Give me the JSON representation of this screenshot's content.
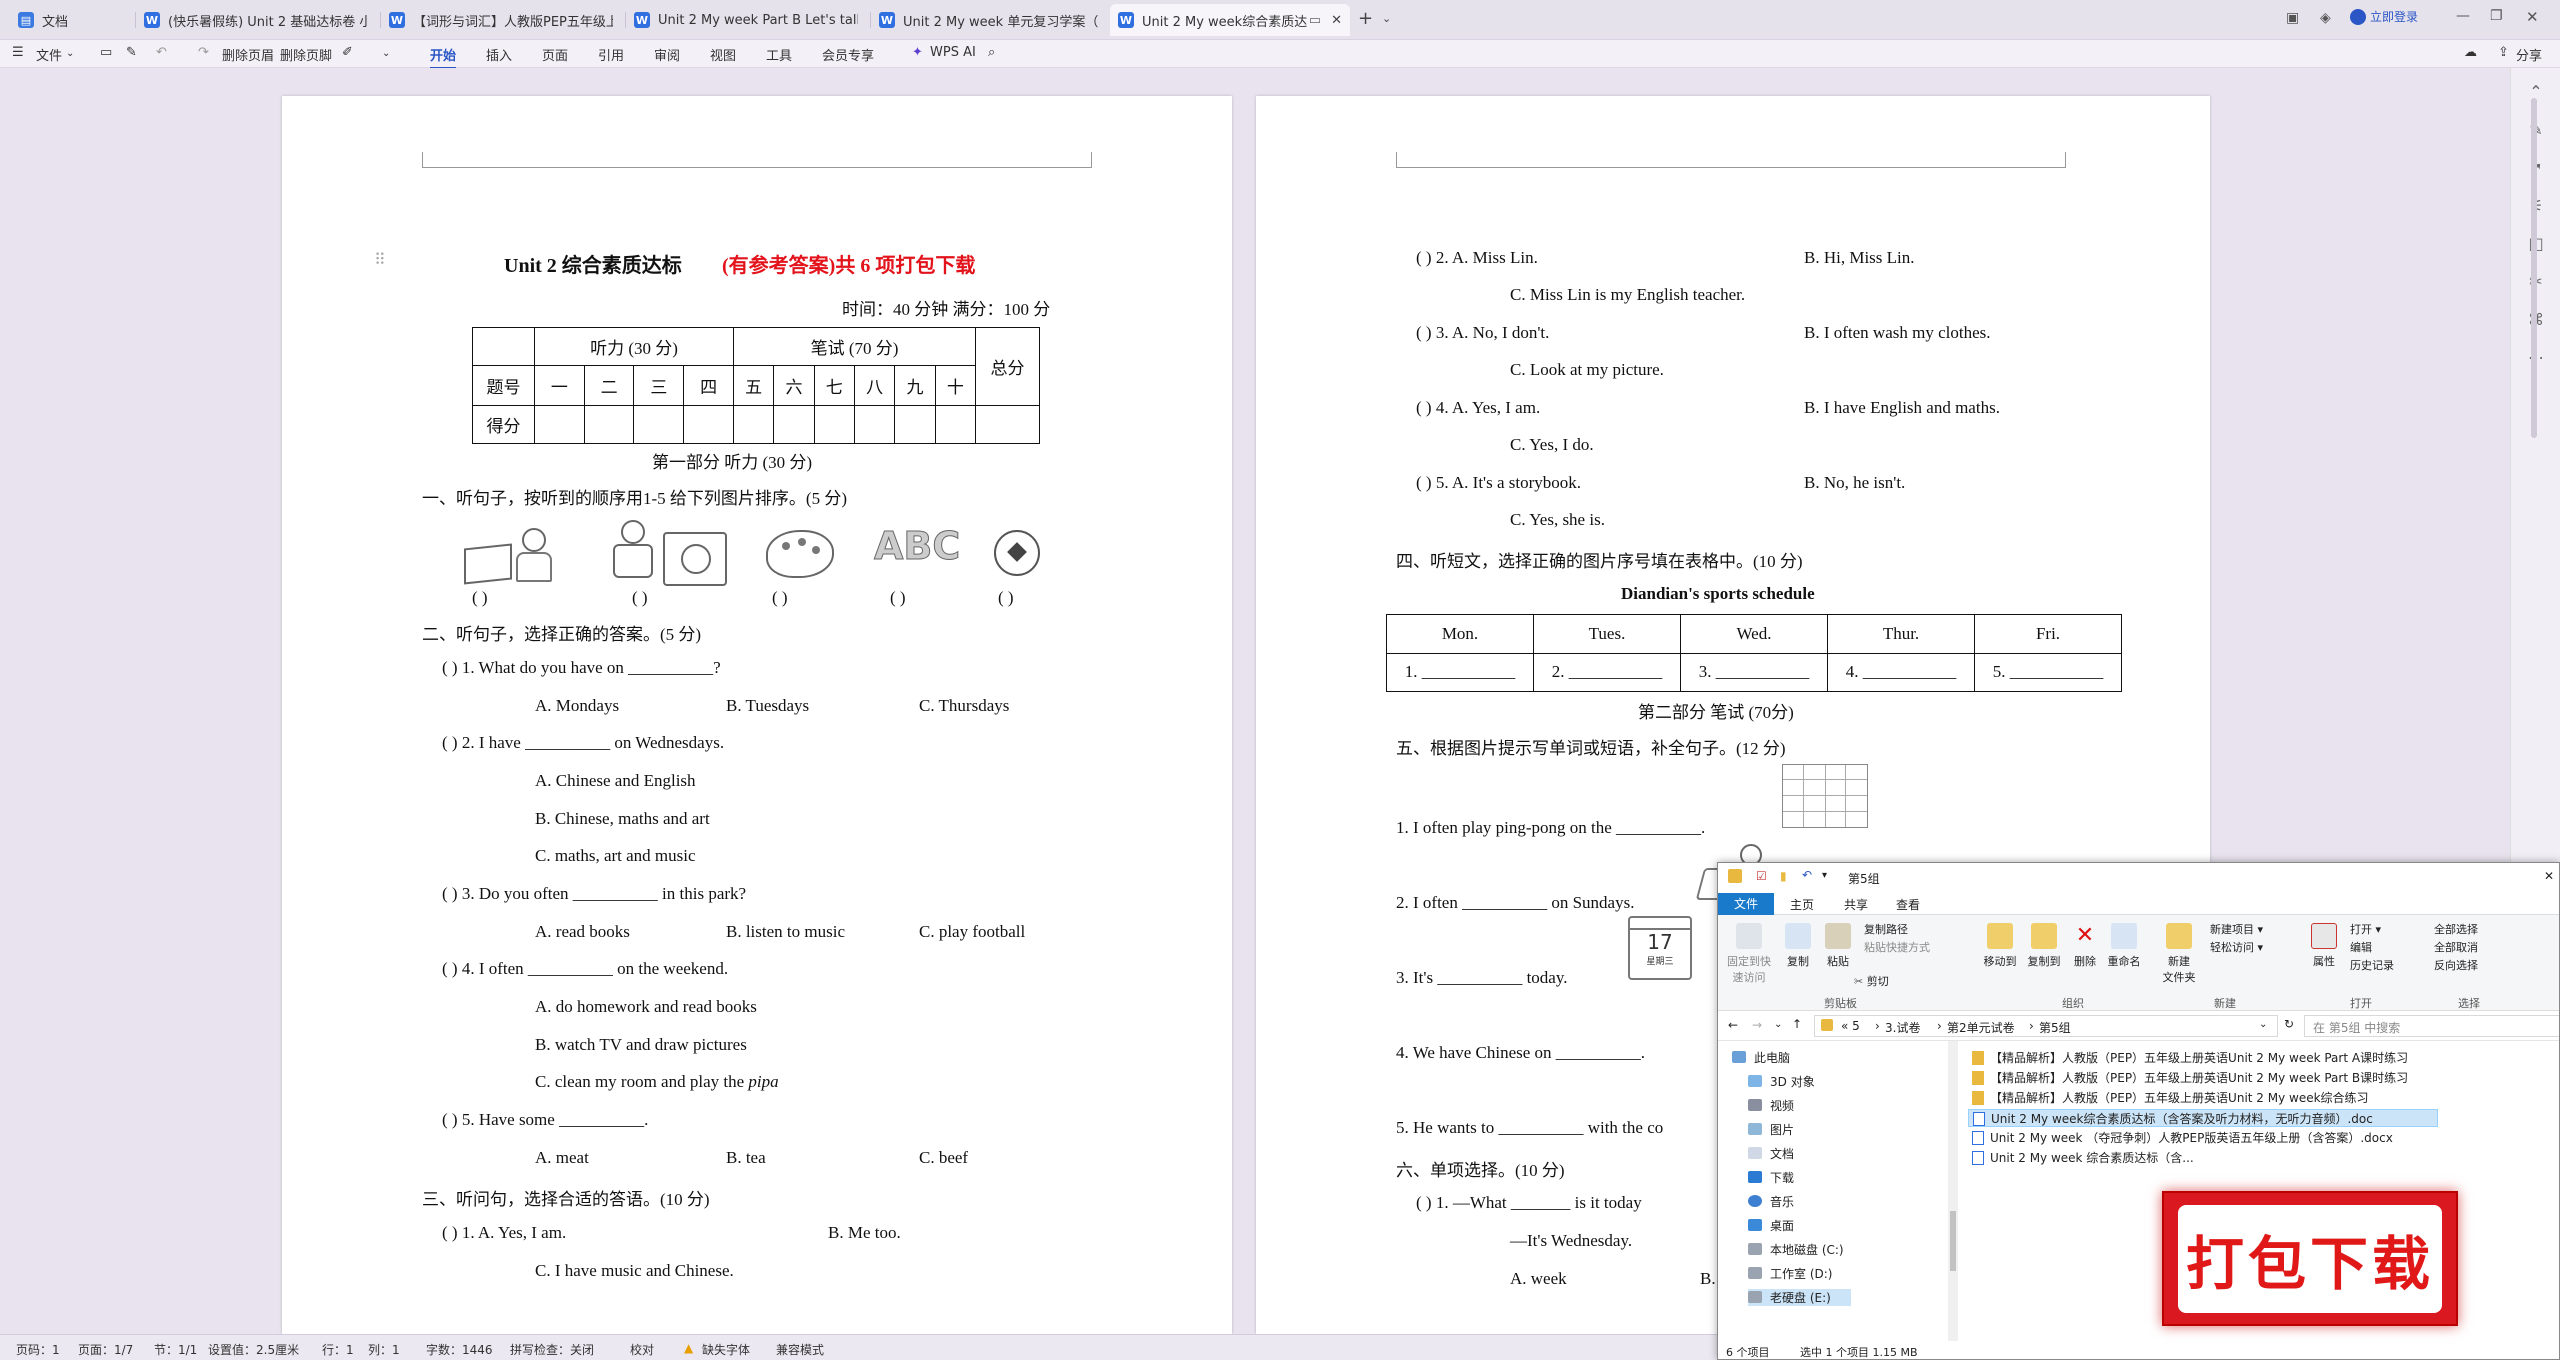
{
  "tabs": [
    {
      "label": "文档",
      "icon": "docs-home-icon",
      "color": "#3b7ae0",
      "active": false
    },
    {
      "label": "(快乐暑假练) Unit 2 基础达标卷 小",
      "icon": "wps-doc-icon",
      "color": "#2f6fe0",
      "active": false
    },
    {
      "label": "【词形与词汇】人教版PEP五年级上册",
      "icon": "wps-doc-icon",
      "color": "#2f6fe0",
      "active": false
    },
    {
      "label": "Unit 2 My week   Part B Let's talk",
      "icon": "wps-doc-icon",
      "color": "#2f6fe0",
      "active": false
    },
    {
      "label": "Unit 2 My week 单元复习学案（知识",
      "icon": "wps-doc-icon",
      "color": "#2f6fe0",
      "active": false
    },
    {
      "label": "Unit 2    My week综合素质达",
      "icon": "wps-doc-icon",
      "color": "#2f6fe0",
      "active": true
    }
  ],
  "titlebar": {
    "login": "立即登录"
  },
  "menu": {
    "file": "文件",
    "delete_header": "删除页眉",
    "delete_footer": "删除页脚",
    "items": [
      "开始",
      "插入",
      "页面",
      "引用",
      "审阅",
      "视图",
      "工具",
      "会员专享"
    ],
    "active": "开始",
    "wps_ai": "WPS AI",
    "share": "分享"
  },
  "left_page": {
    "title": "Unit 2  综合素质达标",
    "title_red": "(有参考答案)共 6 项打包下载",
    "time": "时间：40 分钟    满分：100 分",
    "score_table": {
      "listen": "听力 (30 分)",
      "written": "笔试 (70 分)",
      "total": "总分",
      "row_label": "题号",
      "score_label": "得分",
      "nums": [
        "一",
        "二",
        "三",
        "四",
        "五",
        "六",
        "七",
        "八",
        "九",
        "十"
      ]
    },
    "part1": "第一部分      听力 (30 分)",
    "q1": "一、听句子，按听到的顺序用1-5  给下列图片排序。(5  分)",
    "paren": "(        )",
    "q2": "二、听句子，选择正确的答案。(5  分)",
    "q2_items": [
      {
        "stem": "(        ) 1. What do you have on __________?",
        "opts": [
          "A. Mondays",
          "B. Tuesdays",
          "C. Thursdays"
        ]
      },
      {
        "stem": "(        ) 2. I have __________ on Wednesdays.",
        "opts": [
          "A. Chinese and English",
          "B. Chinese, maths and art",
          "C. maths, art and music"
        ]
      },
      {
        "stem": "(        ) 3. Do you often __________ in this park?",
        "opts": [
          "A. read books",
          "B. listen to music",
          "C. play football"
        ]
      },
      {
        "stem": "(        ) 4. I often __________ on the weekend.",
        "opts": [
          "A. do homework and read books",
          "B. watch TV and draw pictures",
          "C. clean my room and play the "
        ]
      },
      {
        "stem": "(        ) 5. Have some __________.",
        "opts": [
          "A. meat",
          "B. tea",
          "C. beef"
        ]
      }
    ],
    "pipa": "pipa",
    "q3": "三、听问句，选择合适的答语。(10  分)",
    "q3_1": {
      "stem": "(        ) 1. A. Yes, I am.",
      "b": "B. Me too.",
      "c": "C. I have music and Chinese."
    }
  },
  "right_page": {
    "items": [
      {
        "stem": "(        ) 2. A. Miss Lin.",
        "b": "B. Hi, Miss Lin.",
        "c": "C. Miss Lin is my English teacher."
      },
      {
        "stem": "(        ) 3. A. No, I don't.",
        "b": "B. I often wash my clothes.",
        "c": "C. Look at my picture."
      },
      {
        "stem": "(        ) 4. A. Yes, I am.",
        "b": "B. I have English and maths.",
        "c": "C. Yes, I do."
      },
      {
        "stem": "(        ) 5. A. It's a storybook.",
        "b": "B. No, he isn't.",
        "c": "C. Yes, she is."
      }
    ],
    "q4": "四、听短文，选择正确的图片序号填在表格中。(10  分)",
    "schedule_title": "Diandian's sports schedule",
    "days": [
      "Mon.",
      "Tues.",
      "Wed.",
      "Thur.",
      "Fri."
    ],
    "blanks": [
      "1. ___________",
      "2. ___________",
      "3. ___________",
      "4. ___________",
      "5. ___________"
    ],
    "part2": "第二部分    笔试  (70分)",
    "q5": "五、根据图片提示写单词或短语，补全句子。(12  分)",
    "q5_items": [
      "1. I often play ping-pong on the __________.",
      "2. I often __________ on Sundays.",
      "3. It's __________ today.",
      "4. We have Chinese on __________.",
      "5. He wants to __________ with the co"
    ],
    "calendar_day": "17",
    "calendar_week": "星期三",
    "q6": "六、单项选择。(10  分)",
    "q6_1": "(        ) 1. —What _______ is it today",
    "q6_1_ans": "—It's Wednesday.",
    "q6_1_a": "A. week",
    "q6_1_b": "B."
  },
  "status": {
    "page": "页码：1",
    "pages": "页面：1/7",
    "section": "节：1/1",
    "setting": "设置值：2.5厘米",
    "row": "行：1",
    "col": "列：1",
    "words": "字数：1446",
    "spell": "拼写检查：关闭",
    "proof": "校对",
    "font_missing": "缺失字体",
    "compat": "兼容模式"
  },
  "explorer": {
    "title": "第5组",
    "tabs": [
      "文件",
      "主页",
      "共享",
      "查看"
    ],
    "ribbon": {
      "pin": "固定到快\n速访问",
      "copy": "复制",
      "paste": "粘贴",
      "copy_path": "复制路径",
      "paste_shortcut": "粘贴快捷方式",
      "cut": "剪切",
      "move_to": "移动到",
      "copy_to": "复制到",
      "delete": "删除",
      "rename": "重命名",
      "new_folder": "新建\n文件夹",
      "new_item": "新建项目",
      "easy_access": "轻松访问",
      "properties": "属性",
      "open": "打开",
      "edit": "编辑",
      "history": "历史记录",
      "select_all": "全部选择",
      "select_none": "全部取消",
      "invert": "反向选择",
      "g_clipboard": "剪贴板",
      "g_organize": "组织",
      "g_new": "新建",
      "g_open": "打开",
      "g_select": "选择"
    },
    "breadcrumb": [
      "«  5",
      "3.试卷",
      "第2单元试卷",
      "第5组"
    ],
    "search_placeholder": "在 第5组 中搜索",
    "nav": [
      "此电脑",
      "3D 对象",
      "视频",
      "图片",
      "文档",
      "下载",
      "音乐",
      "桌面",
      "本地磁盘 (C:)",
      "工作室 (D:)",
      "老硬盘 (E:)"
    ],
    "files": [
      {
        "name": "【精品解析】人教版（PEP）五年级上册英语Unit 2 My week Part A课时练习",
        "type": "folder"
      },
      {
        "name": "【精品解析】人教版（PEP）五年级上册英语Unit 2 My week Part B课时练习",
        "type": "folder"
      },
      {
        "name": "【精品解析】人教版（PEP）五年级上册英语Unit 2 My week综合练习",
        "type": "folder"
      },
      {
        "name": "Unit 2    My week综合素质达标（含答案及听力材料，无听力音频）.doc",
        "type": "doc",
        "selected": true
      },
      {
        "name": "Unit 2 My week （夺冠争刺）人教PEP版英语五年级上册（含答案）.docx",
        "type": "doc"
      },
      {
        "name": "Unit 2    My week  综合素质达标（含...",
        "type": "doc"
      }
    ],
    "count": "6 个项目",
    "selected": "选中 1 个项目  1.15 MB"
  },
  "badge": "打包下载"
}
